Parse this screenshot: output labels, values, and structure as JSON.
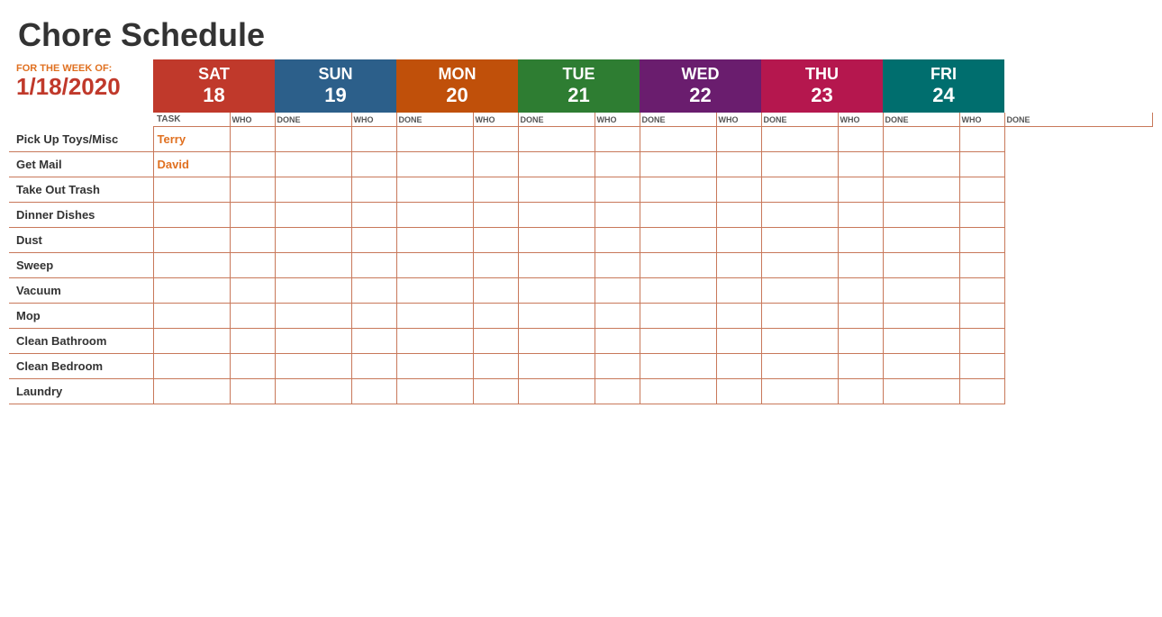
{
  "title": "Chore Schedule",
  "week": {
    "label": "FOR THE WEEK OF:",
    "date": "1/18/2020"
  },
  "days": [
    {
      "name": "SAT",
      "number": "18",
      "color": "sat-bg"
    },
    {
      "name": "SUN",
      "number": "19",
      "color": "sun-bg"
    },
    {
      "name": "MON",
      "number": "20",
      "color": "mon-bg"
    },
    {
      "name": "TUE",
      "number": "21",
      "color": "tue-bg"
    },
    {
      "name": "WED",
      "number": "22",
      "color": "wed-bg"
    },
    {
      "name": "THU",
      "number": "23",
      "color": "thu-bg"
    },
    {
      "name": "FRI",
      "number": "24",
      "color": "fri-bg"
    }
  ],
  "sub_headers": {
    "task": "TASK",
    "who": "WHO",
    "done": "DONE"
  },
  "tasks": [
    {
      "name": "Pick Up Toys/Misc",
      "sat_who": "Terry",
      "sat_who_class": "who-terry",
      "sat_done": "",
      "sun_who": "",
      "sun_done": "",
      "mon_who": "",
      "mon_done": "",
      "tue_who": "",
      "tue_done": "",
      "wed_who": "",
      "wed_done": "",
      "thu_who": "",
      "thu_done": "",
      "fri_who": "",
      "fri_done": ""
    },
    {
      "name": "Get Mail",
      "sat_who": "David",
      "sat_who_class": "who-david",
      "sat_done": "",
      "sun_who": "",
      "sun_done": "",
      "mon_who": "",
      "mon_done": "",
      "tue_who": "",
      "tue_done": "",
      "wed_who": "",
      "wed_done": "",
      "thu_who": "",
      "thu_done": "",
      "fri_who": "",
      "fri_done": ""
    },
    {
      "name": "Take Out Trash",
      "sat_who": "",
      "sat_who_class": "",
      "sat_done": "",
      "sun_who": "",
      "sun_done": "",
      "mon_who": "",
      "mon_done": "",
      "tue_who": "",
      "tue_done": "",
      "wed_who": "",
      "wed_done": "",
      "thu_who": "",
      "thu_done": "",
      "fri_who": "",
      "fri_done": ""
    },
    {
      "name": "Dinner Dishes",
      "sat_who": "",
      "sat_who_class": "",
      "sat_done": "",
      "sun_who": "",
      "sun_done": "",
      "mon_who": "",
      "mon_done": "",
      "tue_who": "",
      "tue_done": "",
      "wed_who": "",
      "wed_done": "",
      "thu_who": "",
      "thu_done": "",
      "fri_who": "",
      "fri_done": ""
    },
    {
      "name": "Dust",
      "sat_who": "",
      "sat_who_class": "",
      "sat_done": "",
      "sun_who": "",
      "sun_done": "",
      "mon_who": "",
      "mon_done": "",
      "tue_who": "",
      "tue_done": "",
      "wed_who": "",
      "wed_done": "",
      "thu_who": "",
      "thu_done": "",
      "fri_who": "",
      "fri_done": ""
    },
    {
      "name": "Sweep",
      "sat_who": "",
      "sat_who_class": "",
      "sat_done": "",
      "sun_who": "",
      "sun_done": "",
      "mon_who": "",
      "mon_done": "",
      "tue_who": "",
      "tue_done": "",
      "wed_who": "",
      "wed_done": "",
      "thu_who": "",
      "thu_done": "",
      "fri_who": "",
      "fri_done": ""
    },
    {
      "name": "Vacuum",
      "sat_who": "",
      "sat_who_class": "",
      "sat_done": "",
      "sun_who": "",
      "sun_done": "",
      "mon_who": "",
      "mon_done": "",
      "tue_who": "",
      "tue_done": "",
      "wed_who": "",
      "wed_done": "",
      "thu_who": "",
      "thu_done": "",
      "fri_who": "",
      "fri_done": ""
    },
    {
      "name": "Mop",
      "sat_who": "",
      "sat_who_class": "",
      "sat_done": "",
      "sun_who": "",
      "sun_done": "",
      "mon_who": "",
      "mon_done": "",
      "tue_who": "",
      "tue_done": "",
      "wed_who": "",
      "wed_done": "",
      "thu_who": "",
      "thu_done": "",
      "fri_who": "",
      "fri_done": ""
    },
    {
      "name": "Clean Bathroom",
      "sat_who": "",
      "sat_who_class": "",
      "sat_done": "",
      "sun_who": "",
      "sun_done": "",
      "mon_who": "",
      "mon_done": "",
      "tue_who": "",
      "tue_done": "",
      "wed_who": "",
      "wed_done": "",
      "thu_who": "",
      "thu_done": "",
      "fri_who": "",
      "fri_done": ""
    },
    {
      "name": "Clean Bedroom",
      "sat_who": "",
      "sat_who_class": "",
      "sat_done": "",
      "sun_who": "",
      "sun_done": "",
      "mon_who": "",
      "mon_done": "",
      "tue_who": "",
      "tue_done": "",
      "wed_who": "",
      "wed_done": "",
      "thu_who": "",
      "thu_done": "",
      "fri_who": "",
      "fri_done": ""
    },
    {
      "name": "Laundry",
      "sat_who": "",
      "sat_who_class": "",
      "sat_done": "",
      "sun_who": "",
      "sun_done": "",
      "mon_who": "",
      "mon_done": "",
      "tue_who": "",
      "tue_done": "",
      "wed_who": "",
      "wed_done": "",
      "thu_who": "",
      "thu_done": "",
      "fri_who": "",
      "fri_done": ""
    }
  ]
}
